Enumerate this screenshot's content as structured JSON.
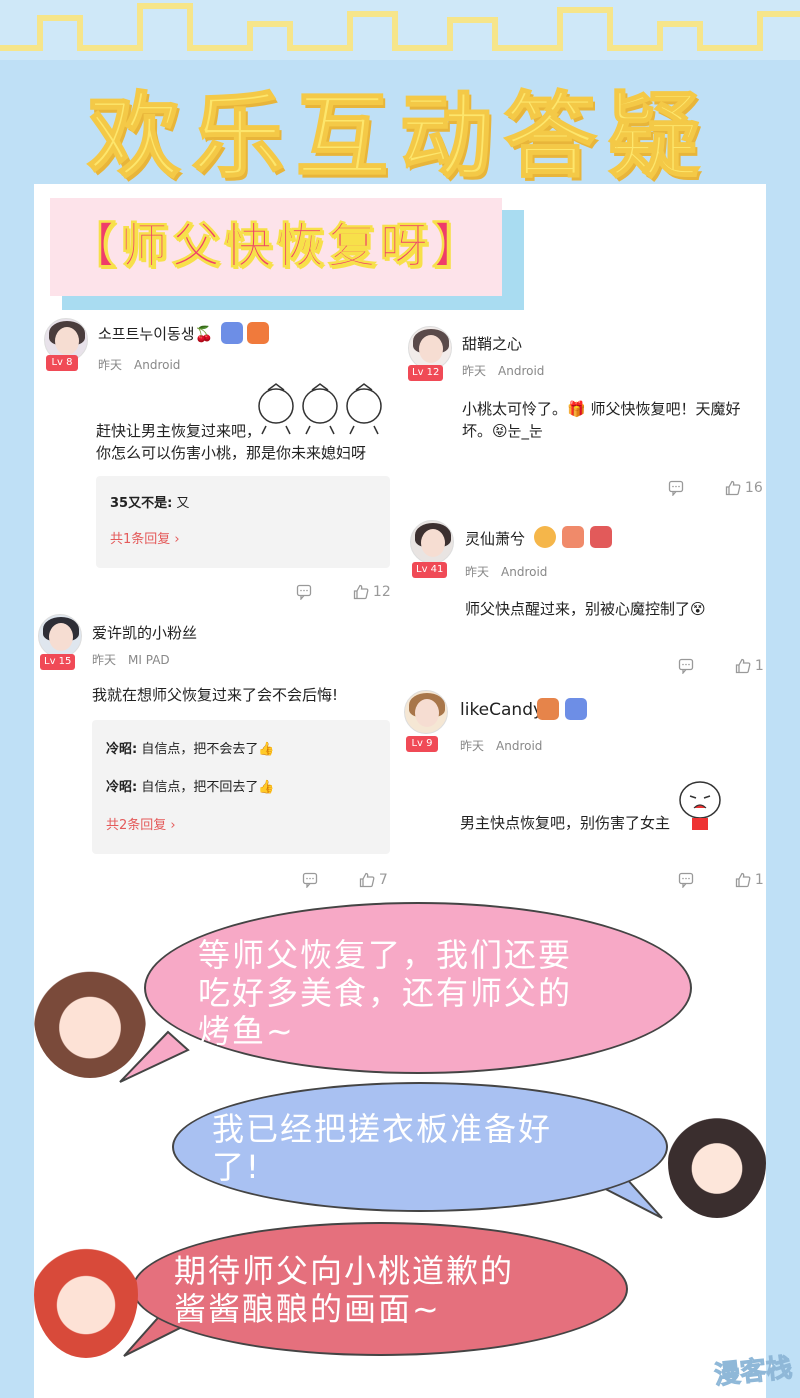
{
  "page": {
    "title": "欢乐互动答疑",
    "subtitle": "【师父快恢复呀】",
    "watermark": "漫客栈"
  },
  "comments": [
    {
      "username": "소프트누이동생🍒",
      "level": "Lv 8",
      "time": "昨天",
      "device": "Android",
      "text": "赶快让男主恢复过来吧，\n你怎么可以伤害小桃，那是你未来媳妇呀",
      "replies": [
        {
          "user": "35又不是:",
          "text": " 又"
        }
      ],
      "more_replies": "共1条回复 ›",
      "likes": "12",
      "badges": [
        "badge-6",
        "badge-6"
      ]
    },
    {
      "username": "甜鞘之心",
      "level": "Lv 12",
      "time": "昨天",
      "device": "Android",
      "text": "小桃太可怜了。🎁 师父快恢复吧！天魔好\n坏。😝눈_눈",
      "likes": "16"
    },
    {
      "username": "灵仙萧兮",
      "level": "Lv 41",
      "time": "昨天",
      "device": "Android",
      "text": "师父快点醒过来，别被心魔控制了😵",
      "likes": "1"
    },
    {
      "username": "爱许凯的小粉丝",
      "level": "Lv 15",
      "time": "昨天",
      "device": "MI PAD",
      "text": "我就在想师父恢复过来了会不会后悔!",
      "replies": [
        {
          "user": "冷昭:",
          "text": " 自信点，把不会去了👍"
        },
        {
          "user": "冷昭:",
          "text": " 自信点，把不回去了👍"
        }
      ],
      "more_replies": "共2条回复 ›",
      "likes": "7"
    },
    {
      "username": "likeCandy",
      "level": "Lv 9",
      "time": "昨天",
      "device": "Android",
      "text": "男主快点恢复吧，别伤害了女主",
      "likes": "1"
    }
  ],
  "bubbles": [
    {
      "text": "等师父恢复了，我们还要\n吃好多美食，还有师父的\n烤鱼~",
      "color": "#f7a9c6"
    },
    {
      "text": "我已经把搓衣板准备好\n了!",
      "color": "#a9c1f2"
    },
    {
      "text": "期待师父向小桃道歉的\n酱酱酿酿的画面~",
      "color": "#e5707d"
    }
  ],
  "colors": {
    "background": "#bfe0f6",
    "title_fill": "#fde66c",
    "subtitle_bg": "#fde3ea",
    "subtitle_text": "#ef3d6a",
    "level_badge": "#f04a56",
    "reply_link": "#e45a5a"
  }
}
